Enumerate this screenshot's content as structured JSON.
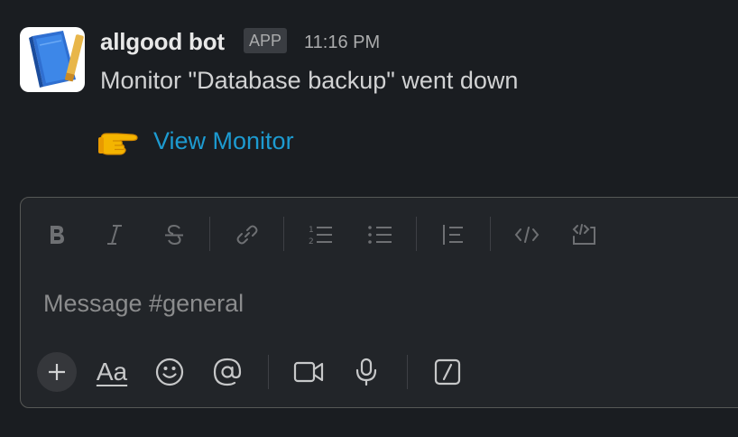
{
  "message": {
    "sender": "allgood bot",
    "badge": "APP",
    "time": "11:16 PM",
    "text": "Monitor \"Database backup\" went down",
    "link_text": "View Monitor",
    "link_emoji": "backhand-index-pointing-right"
  },
  "composer": {
    "placeholder": "Message #general",
    "formatting_icons": [
      "bold-icon",
      "italic-icon",
      "strikethrough-icon",
      "link-icon",
      "numbered-list-icon",
      "bulleted-list-icon",
      "blockquote-icon",
      "code-icon",
      "code-block-icon"
    ],
    "bottom_icons": [
      "plus-icon",
      "text-format-icon",
      "emoji-icon",
      "mention-icon",
      "video-icon",
      "microphone-icon",
      "slash-command-icon"
    ],
    "format_toggle_label": "Aa"
  },
  "colors": {
    "background": "#1a1d21",
    "composer_background": "#222529",
    "link": "#1d9bd1",
    "muted_icon": "#6e7073",
    "active_icon": "#c7c8c9"
  }
}
